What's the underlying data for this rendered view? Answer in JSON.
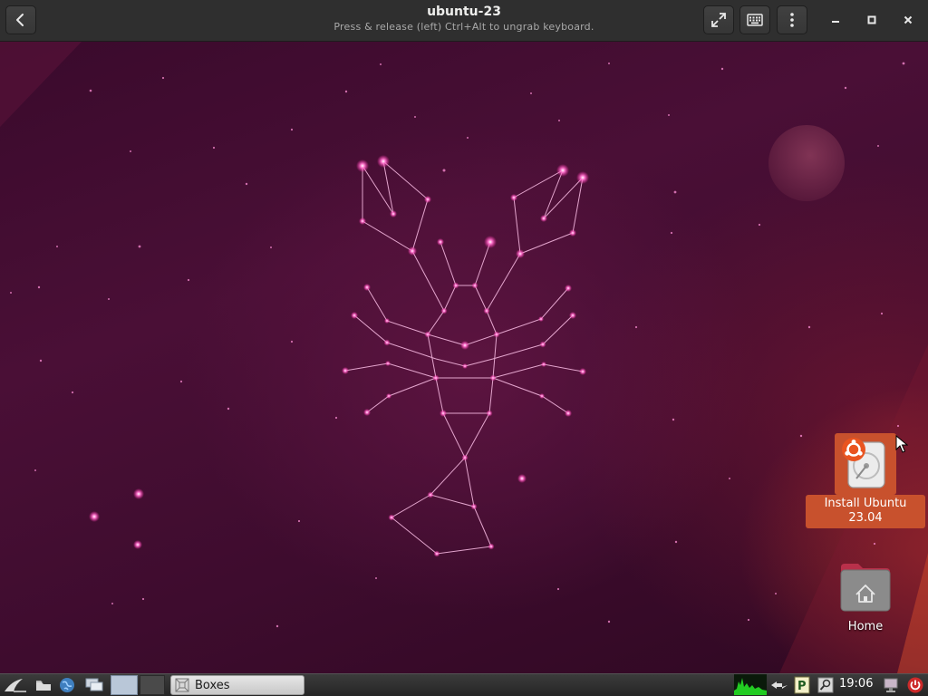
{
  "header": {
    "title": "ubuntu-23",
    "subtitle": "Press & release (left) Ctrl+Alt to ungrab keyboard.",
    "back_icon": "chevron-left-icon",
    "fullscreen_icon": "fullscreen-icon",
    "keyboard_icon": "keyboard-icon",
    "menu_icon": "kebab-menu-icon",
    "minimize_icon": "minimize-icon",
    "maximize_icon": "maximize-icon",
    "close_icon": "close-icon"
  },
  "desktop": {
    "wallpaper": "ubuntu-23.04-lobster-constellation",
    "icons": [
      {
        "label": "Install Ubuntu\n23.04",
        "line1": "Install Ubuntu",
        "line2": "23.04",
        "icon": "ubuntu-installer-icon",
        "selected": true
      },
      {
        "label": "Home",
        "icon": "home-folder-icon",
        "selected": false
      }
    ]
  },
  "taskbar": {
    "launchers": [
      "start-menu-icon",
      "file-manager-icon",
      "web-browser-icon",
      "show-desktop-icon"
    ],
    "workspaces": [
      "1",
      "2"
    ],
    "active_workspace": "1",
    "task": {
      "label": "Boxes",
      "icon": "boxes-icon"
    },
    "tray": [
      "cpu-monitor-icon",
      "network-icon",
      "package-updates-icon",
      "search-icon"
    ],
    "clock": "19:06",
    "extra": [
      "display-icon",
      "power-icon"
    ]
  },
  "colors": {
    "header_bg": "#2f2f2f",
    "desktop_bg": "#4a0f36",
    "accent": "#c8512d",
    "star": "#ff6ec7"
  }
}
